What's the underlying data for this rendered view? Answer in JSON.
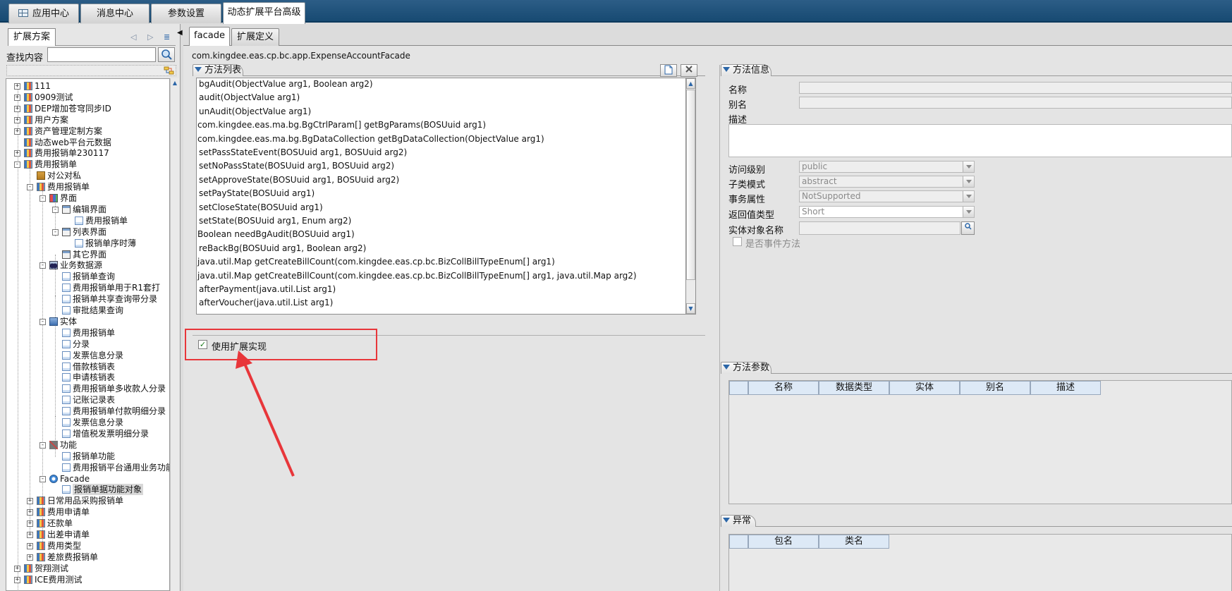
{
  "top_tabs": [
    {
      "label": "应用中心"
    },
    {
      "label": "消息中心"
    },
    {
      "label": "参数设置"
    },
    {
      "label": "动态扩展平台高级版"
    }
  ],
  "left_panel": {
    "tab_label": "扩展方案",
    "search_label": "查找内容",
    "search_value": "",
    "tree": [
      {
        "label": "111"
      },
      {
        "label": "0909测试"
      },
      {
        "label": "DEP增加苍穹同步ID"
      },
      {
        "label": "用户方案"
      },
      {
        "label": "资产管理定制方案"
      },
      {
        "label": "动态web平台元数据"
      },
      {
        "label": "费用报销单230117"
      },
      {
        "label": "费用报销单"
      },
      {
        "label": "对公对私"
      },
      {
        "label": "费用报销单"
      },
      {
        "label": "界面"
      },
      {
        "label": "编辑界面"
      },
      {
        "label": "费用报销单"
      },
      {
        "label": "列表界面"
      },
      {
        "label": "报销单序时薄"
      },
      {
        "label": "其它界面"
      },
      {
        "label": "业务数据源"
      },
      {
        "label": "报销单查询"
      },
      {
        "label": "费用报销单用于R1套打"
      },
      {
        "label": "报销单共享查询带分录"
      },
      {
        "label": "审批结果查询"
      },
      {
        "label": "实体"
      },
      {
        "label": "费用报销单"
      },
      {
        "label": "分录"
      },
      {
        "label": "发票信息分录"
      },
      {
        "label": "借款核销表"
      },
      {
        "label": "申请核销表"
      },
      {
        "label": "费用报销单多收款人分录"
      },
      {
        "label": "记账记录表"
      },
      {
        "label": "费用报销单付款明细分录"
      },
      {
        "label": "发票信息分录"
      },
      {
        "label": "增值税发票明细分录"
      },
      {
        "label": "功能"
      },
      {
        "label": "报销单功能"
      },
      {
        "label": "费用报销平台通用业务功能"
      },
      {
        "label": "Facade"
      },
      {
        "label": "报销单据功能对象"
      },
      {
        "label": "日常用品采购报销单"
      },
      {
        "label": "费用申请单"
      },
      {
        "label": "还款单"
      },
      {
        "label": "出差申请单"
      },
      {
        "label": "费用类型"
      },
      {
        "label": "差旅费报销单"
      },
      {
        "label": "贺翔测试"
      },
      {
        "label": "ICE费用测试"
      }
    ]
  },
  "main_tabs": [
    {
      "label": "facade"
    },
    {
      "label": "扩展定义"
    }
  ],
  "facade_path": "com.kingdee.eas.cp.bc.app.ExpenseAccountFacade",
  "method_list": {
    "title": "方法列表",
    "items": [
      "bgAudit(ObjectValue arg1, Boolean arg2)",
      "audit(ObjectValue arg1)",
      "unAudit(ObjectValue arg1)",
      "com.kingdee.eas.ma.bg.BgCtrlParam[] getBgParams(BOSUuid arg1)",
      "com.kingdee.eas.ma.bg.BgDataCollection getBgDataCollection(ObjectValue arg1)",
      "setPassStateEvent(BOSUuid arg1, BOSUuid arg2)",
      "setNoPassState(BOSUuid arg1, BOSUuid arg2)",
      "setApproveState(BOSUuid arg1, BOSUuid arg2)",
      "setPayState(BOSUuid arg1)",
      "setCloseState(BOSUuid arg1)",
      "setState(BOSUuid arg1, Enum arg2)",
      "Boolean needBgAudit(BOSUuid arg1)",
      "reBackBg(BOSUuid arg1, Boolean arg2)",
      "java.util.Map getCreateBillCount(com.kingdee.eas.cp.bc.BizCollBillTypeEnum[] arg1)",
      "java.util.Map getCreateBillCount(com.kingdee.eas.cp.bc.BizCollBillTypeEnum[] arg1, java.util.Map arg2)",
      "afterPayment(java.util.List arg1)",
      "afterVoucher(java.util.List arg1)"
    ]
  },
  "use_extension": {
    "label": "使用扩展实现",
    "checked": true
  },
  "method_info": {
    "title": "方法信息",
    "name_label": "名称",
    "alias_label": "别名",
    "desc_label": "描述",
    "access_label": "访问级别",
    "access_value": "public",
    "subclass_label": "子类模式",
    "subclass_value": "abstract",
    "tx_label": "事务属性",
    "tx_value": "NotSupported",
    "return_label": "返回值类型",
    "return_value": "Short",
    "entity_name_label": "实体对象名称",
    "event_method_label": "是否事件方法"
  },
  "method_params": {
    "title": "方法参数",
    "columns": [
      "名称",
      "数据类型",
      "实体",
      "别名",
      "描述"
    ]
  },
  "exceptions": {
    "title": "异常",
    "columns": [
      "包名",
      "类名"
    ]
  }
}
